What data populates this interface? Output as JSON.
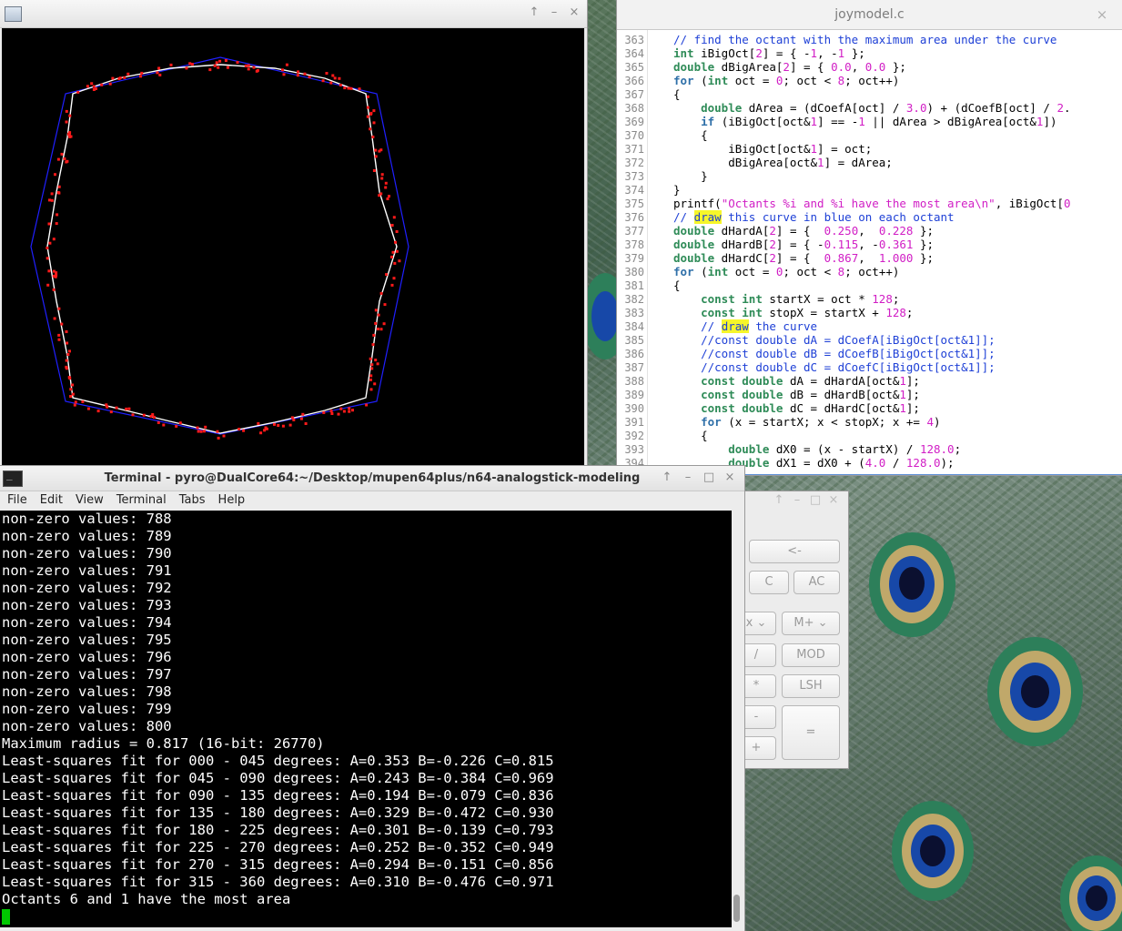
{
  "plot_window": {
    "title": "",
    "buttons": [
      "↑",
      "–",
      "×"
    ]
  },
  "editor": {
    "title": "joymodel.c",
    "close": "×",
    "highlight_word": "draw",
    "lines": [
      {
        "n": "363",
        "text": "        // find the octant with the maximum area under the curve"
      },
      {
        "n": "364",
        "text": "        int iBigOct[2] = { -1, -1 };"
      },
      {
        "n": "365",
        "text": "        double dBigArea[2] = { 0.0, 0.0 };"
      },
      {
        "n": "366",
        "text": "        for (int oct = 0; oct < 8; oct++)"
      },
      {
        "n": "367",
        "text": "        {"
      },
      {
        "n": "368",
        "text": "            double dArea = (dCoefA[oct] / 3.0) + (dCoefB[oct] / 2."
      },
      {
        "n": "369",
        "text": "            if (iBigOct[oct&1] == -1 || dArea > dBigArea[oct&1])"
      },
      {
        "n": "370",
        "text": "            {"
      },
      {
        "n": "371",
        "text": "                iBigOct[oct&1] = oct;"
      },
      {
        "n": "372",
        "text": "                dBigArea[oct&1] = dArea;"
      },
      {
        "n": "373",
        "text": "            }"
      },
      {
        "n": "374",
        "text": "        }"
      },
      {
        "n": "375",
        "text": "        printf(\"Octants %i and %i have the most area\\n\", iBigOct[0"
      },
      {
        "n": "376",
        "text": "        // draw this curve in blue on each octant"
      },
      {
        "n": "377",
        "text": "        double dHardA[2] = {  0.250,  0.228 };"
      },
      {
        "n": "378",
        "text": "        double dHardB[2] = { -0.115, -0.361 };"
      },
      {
        "n": "379",
        "text": "        double dHardC[2] = {  0.867,  1.000 };"
      },
      {
        "n": "380",
        "text": "        for (int oct = 0; oct < 8; oct++)"
      },
      {
        "n": "381",
        "text": "        {"
      },
      {
        "n": "382",
        "text": "            const int startX = oct * 128;"
      },
      {
        "n": "383",
        "text": "            const int stopX = startX + 128;"
      },
      {
        "n": "384",
        "text": "            // draw the curve"
      },
      {
        "n": "385",
        "text": "            //const double dA = dCoefA[iBigOct[oct&1]];"
      },
      {
        "n": "386",
        "text": "            //const double dB = dCoefB[iBigOct[oct&1]];"
      },
      {
        "n": "387",
        "text": "            //const double dC = dCoefC[iBigOct[oct&1]];"
      },
      {
        "n": "388",
        "text": "            const double dA = dHardA[oct&1];"
      },
      {
        "n": "389",
        "text": "            const double dB = dHardB[oct&1];"
      },
      {
        "n": "390",
        "text": "            const double dC = dHardC[oct&1];"
      },
      {
        "n": "391",
        "text": "            for (x = startX; x < stopX; x += 4)"
      },
      {
        "n": "392",
        "text": "            {"
      },
      {
        "n": "393",
        "text": "                double dX0 = (x - startX) / 128.0;"
      },
      {
        "n": "394",
        "text": "                double dX1 = dX0 + (4.0 / 128.0);"
      }
    ]
  },
  "calculator": {
    "title_buttons": [
      "↑",
      "–",
      "□",
      "×"
    ],
    "buttons": {
      "back": "<-",
      "clear": "C",
      "all_clear": "AC",
      "x_select": "x",
      "mplus": "M+",
      "divide": "/",
      "mod": "MOD",
      "multiply": "*",
      "lsh": "LSH",
      "minus": "-",
      "plus": "+",
      "equals": "="
    }
  },
  "terminal": {
    "title": "Terminal - pyro@DualCore64:~/Desktop/mupen64plus/n64-analogstick-modeling",
    "buttons": [
      "↑",
      "–",
      "□",
      "×"
    ],
    "menu": [
      "File",
      "Edit",
      "View",
      "Terminal",
      "Tabs",
      "Help"
    ],
    "lines": [
      "non-zero values: 788",
      "non-zero values: 789",
      "non-zero values: 790",
      "non-zero values: 791",
      "non-zero values: 792",
      "non-zero values: 793",
      "non-zero values: 794",
      "non-zero values: 795",
      "non-zero values: 796",
      "non-zero values: 797",
      "non-zero values: 798",
      "non-zero values: 799",
      "non-zero values: 800",
      "Maximum radius = 0.817 (16-bit: 26770)",
      "Least-squares fit for 000 - 045 degrees: A=0.353 B=-0.226 C=0.815",
      "Least-squares fit for 045 - 090 degrees: A=0.243 B=-0.384 C=0.969",
      "Least-squares fit for 090 - 135 degrees: A=0.194 B=-0.079 C=0.836",
      "Least-squares fit for 135 - 180 degrees: A=0.329 B=-0.472 C=0.930",
      "Least-squares fit for 180 - 225 degrees: A=0.301 B=-0.139 C=0.793",
      "Least-squares fit for 225 - 270 degrees: A=0.252 B=-0.352 C=0.949",
      "Least-squares fit for 270 - 315 degrees: A=0.294 B=-0.151 C=0.856",
      "Least-squares fit for 315 - 360 degrees: A=0.310 B=-0.476 C=0.971",
      "Octants 6 and 1 have the most area"
    ]
  },
  "colors": {
    "plot_background": "#000000",
    "outer_curve": "#2020ff",
    "fit_curve": "#ffffff",
    "sample_points": "#ff1a1a",
    "terminal_background": "#000000",
    "terminal_text": "#ffffff",
    "cursor": "#00c800",
    "code_keyword": "#2e6fa8",
    "code_comment": "#1d3fd6",
    "code_number": "#d11ec5",
    "code_highlight": "#f6f62a"
  }
}
